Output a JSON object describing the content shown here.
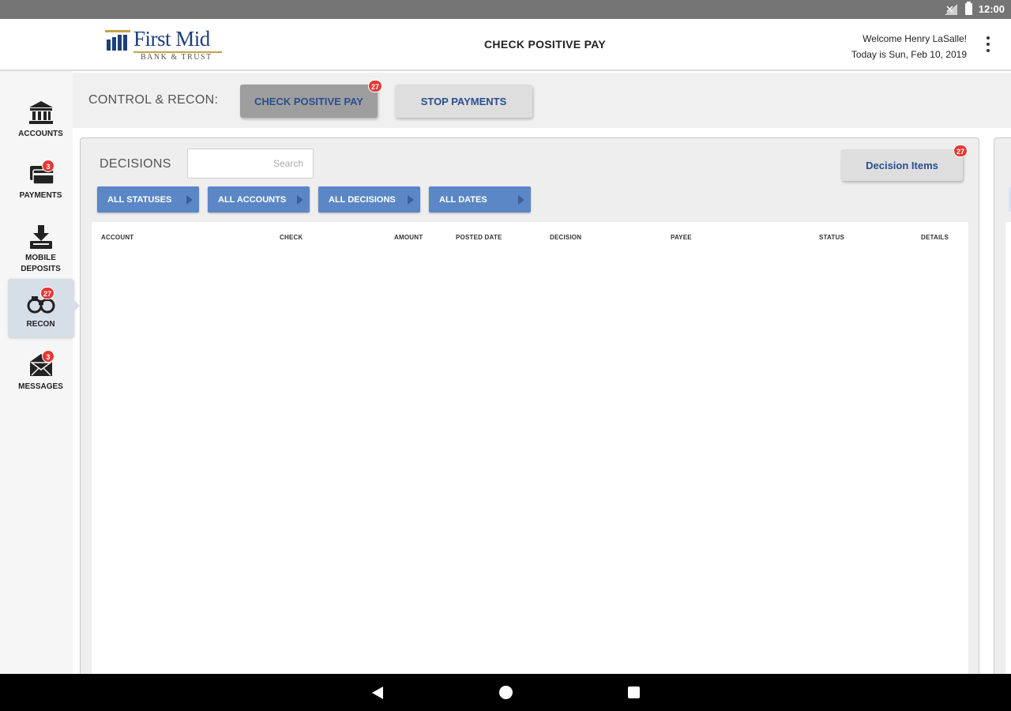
{
  "status_bar": {
    "time": "12:00"
  },
  "header": {
    "logo_name": "First Mid",
    "logo_sub": "BANK & TRUST",
    "title": "CHECK POSITIVE PAY",
    "welcome": "Welcome Henry LaSalle!",
    "date": "Today is Sun, Feb 10, 2019"
  },
  "sidebar": {
    "items": [
      {
        "label": "ACCOUNTS",
        "icon": "bank-icon"
      },
      {
        "label": "PAYMENTS",
        "icon": "payment-card-icon",
        "badge": "3"
      },
      {
        "label": "MOBILE DEPOSITS",
        "icon": "download-deposit-icon"
      },
      {
        "label": "RECON",
        "icon": "binoculars-icon",
        "badge": "27",
        "active": true
      },
      {
        "label": "MESSAGES",
        "icon": "envelope-icon",
        "badge": "3"
      }
    ]
  },
  "toolbar": {
    "label": "CONTROL & RECON:",
    "tabs": [
      {
        "label": "CHECK POSITIVE PAY",
        "badge": "27",
        "active": true
      },
      {
        "label": "STOP PAYMENTS"
      }
    ]
  },
  "decisions": {
    "label": "DECISIONS",
    "search_placeholder": "Search",
    "decision_items_label": "Decision Items",
    "decision_items_badge": "27",
    "filters": [
      "ALL STATUSES",
      "ALL ACCOUNTS",
      "ALL DECISIONS",
      "ALL DATES"
    ],
    "columns": [
      "ACCOUNT",
      "CHECK",
      "AMOUNT",
      "POSTED DATE",
      "DECISION",
      "PAYEE",
      "STATUS",
      "DETAILS"
    ],
    "rows": []
  },
  "colors": {
    "brand_blue": "#1d3f7a",
    "filter_blue": "#5b87c6",
    "badge_red": "#e53935",
    "logo_gold": "#c7a04a"
  }
}
